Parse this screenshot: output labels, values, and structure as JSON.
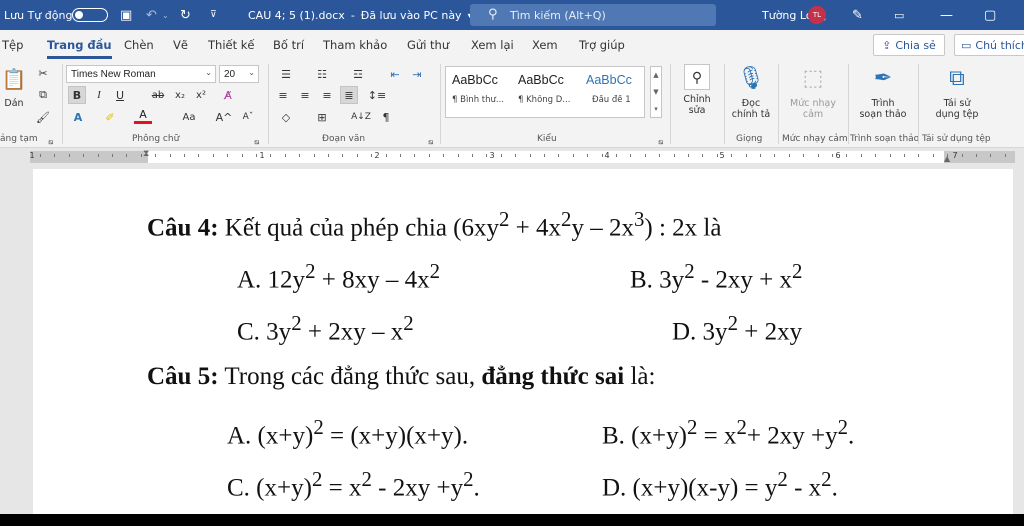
{
  "titlebar": {
    "autosave_label": "Lưu Tự động",
    "doc_title": "CAU 4; 5 (1).docx",
    "save_status": "Đã lưu vào PC này",
    "search_placeholder": "Tìm kiếm (Alt+Q)",
    "user_name": "Tường Long",
    "user_initials": "TL"
  },
  "menu": {
    "items": [
      "Tệp",
      "Trang đầu",
      "Chèn",
      "Vẽ",
      "Thiết kế",
      "Bố trí",
      "Tham khảo",
      "Gửi thư",
      "Xem lại",
      "Xem",
      "Trợ giúp"
    ],
    "active_index": 1,
    "share_label": "Chia sẻ",
    "comment_label": "Chú thích"
  },
  "ribbon": {
    "paste_label": "Dán",
    "font_name": "Times New Roman",
    "font_size": "20",
    "case_label": "Aa",
    "styles": [
      {
        "sample": "AaBbCc",
        "name": "¶ Bình thư..."
      },
      {
        "sample": "AaBbCc",
        "name": "¶ Không D..."
      },
      {
        "sample": "AaBbCc",
        "name": "Đầu đề 1"
      }
    ],
    "edit_label_1": "Chỉnh",
    "edit_label_2": "sửa",
    "dictate_label_1": "Đọc",
    "dictate_label_2": "chính tả",
    "sensitivity_label_1": "Mức nhạy",
    "sensitivity_label_2": "cảm",
    "editor_label_1": "Trình",
    "editor_label_2": "soạn thảo",
    "reuse_label_1": "Tái sử",
    "reuse_label_2": "dụng tệp",
    "groups": {
      "clipboard": "ảng tạm",
      "font": "Phông chữ",
      "paragraph": "Đoạn văn",
      "styles": "Kiểu",
      "voice": "Giọng",
      "sensitivity": "Mức nhạy cảm",
      "editor": "Trình soạn thảo",
      "reuse": "Tái sử dụng tệp"
    }
  },
  "ruler": {
    "numbers": [
      "1",
      "1",
      "2",
      "3",
      "4",
      "5",
      "6",
      "7"
    ]
  },
  "document": {
    "q4_label": "Câu 4:",
    "q4_text_pre": " Kết quả của phép chia (6xy",
    "q4_text_mid1": " + 4x",
    "q4_text_mid2": "y – 2x",
    "q4_text_post": ") : 2x là",
    "q4_a_pre": "A. 12y",
    "q4_a_mid": " + 8xy – 4x",
    "q4_b_pre": "B. 3y",
    "q4_b_mid": " - 2xy + x",
    "q4_c_pre": "C. 3y",
    "q4_c_mid": " + 2xy – x",
    "q4_d_pre": "D. 3y",
    "q4_d_post": " + 2xy",
    "q5_label": "Câu 5:",
    "q5_text_pre": " Trong các đẳng thức sau, ",
    "q5_text_bold": "đẳng thức sai",
    "q5_text_post": " là:",
    "q5_a_pre": "A. (x+y)",
    "q5_a_post": " = (x+y)(x+y).",
    "q5_b_pre": "B. (x+y)",
    "q5_b_mid1": " = x",
    "q5_b_mid2": "+ 2xy +y",
    "q5_b_post": ".",
    "q5_c_pre": "C. (x+y)",
    "q5_c_mid1": " = x",
    "q5_c_mid2": " - 2xy +y",
    "q5_c_post": ".",
    "q5_d_pre": "D. (x+y)(x-y) = y",
    "q5_d_mid": " - x",
    "q5_d_post": ".",
    "sup2": "2",
    "sup3": "3"
  }
}
